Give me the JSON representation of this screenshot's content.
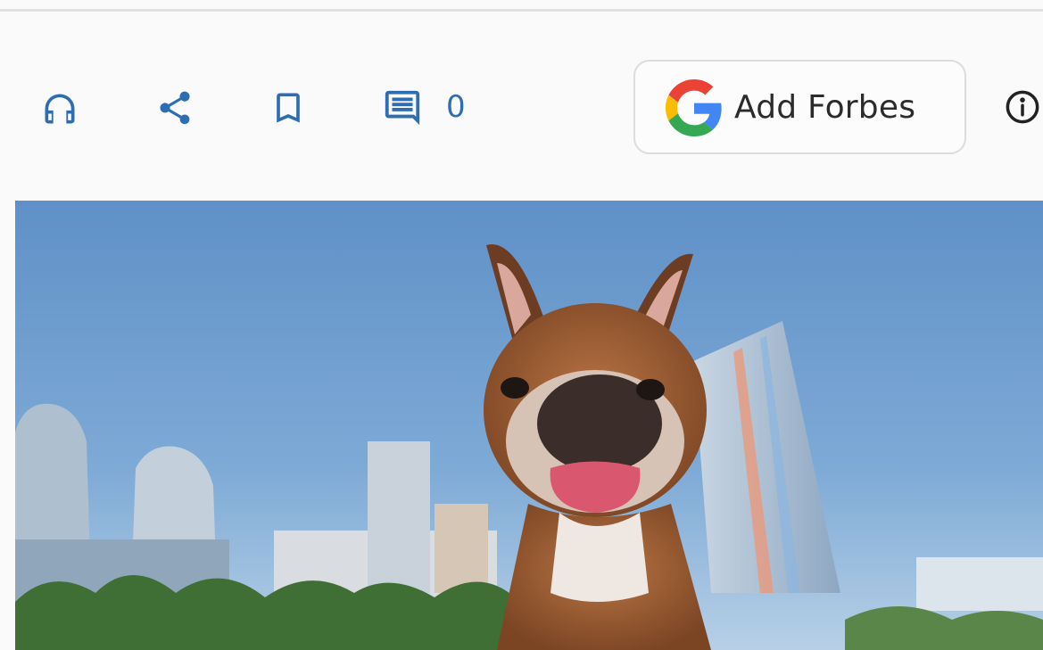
{
  "toolbar": {
    "listen_icon": "headphones-icon",
    "share_icon": "share-icon",
    "save_icon": "bookmark-icon",
    "comments_icon": "comment-icon",
    "comment_count": "0",
    "add_source_label": "Add Forbes",
    "add_source_logo": "google-g-logo",
    "info_icon": "info-icon"
  },
  "hero_image": {
    "subject": "french-bulldog-photo"
  },
  "colors": {
    "accent": "#2f6db3",
    "button_border": "#dcdcdc",
    "sky": "#6f9fcf"
  }
}
